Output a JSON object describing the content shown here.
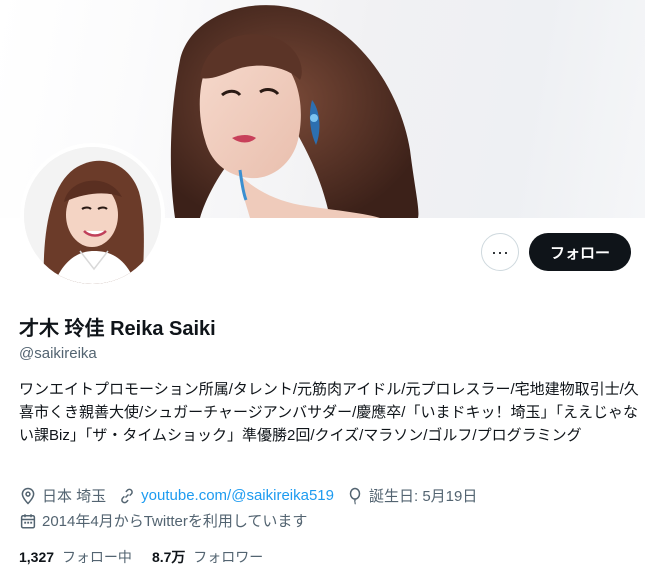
{
  "profile": {
    "display_name": "才木 玲佳 Reika Saiki",
    "handle": "@saikireika",
    "bio": "ワンエイトプロモーション所属/タレント/元筋肉アイドル/元プロレスラー/宅地建物取引士/久喜市くき親善大使/シュガーチャージアンバサダー/慶應卒/「いまドキッ！埼玉」「ええじゃない課Biz」「ザ・タイムショック」準優勝2回/クイズ/マラソン/ゴルフ/プログラミング"
  },
  "actions": {
    "more_label": "···",
    "follow_label": "フォロー"
  },
  "meta": {
    "location": "日本 埼玉",
    "website": "youtube.com/@saikireika519",
    "birthday": "誕生日: 5月19日",
    "joined": "2014年4月からTwitterを利用しています"
  },
  "stats": {
    "following_count": "1,327",
    "following_label": "フォロー中",
    "followers_count": "8.7万",
    "followers_label": "フォロワー"
  },
  "icons": {
    "location": "location-pin-icon",
    "website": "link-icon",
    "birthday": "balloon-icon",
    "joined": "calendar-icon",
    "more": "more-dots-icon"
  },
  "colors": {
    "text": "#0f1419",
    "secondary": "#536471",
    "link": "#1d9bf0",
    "follow_bg": "#0f1419"
  }
}
